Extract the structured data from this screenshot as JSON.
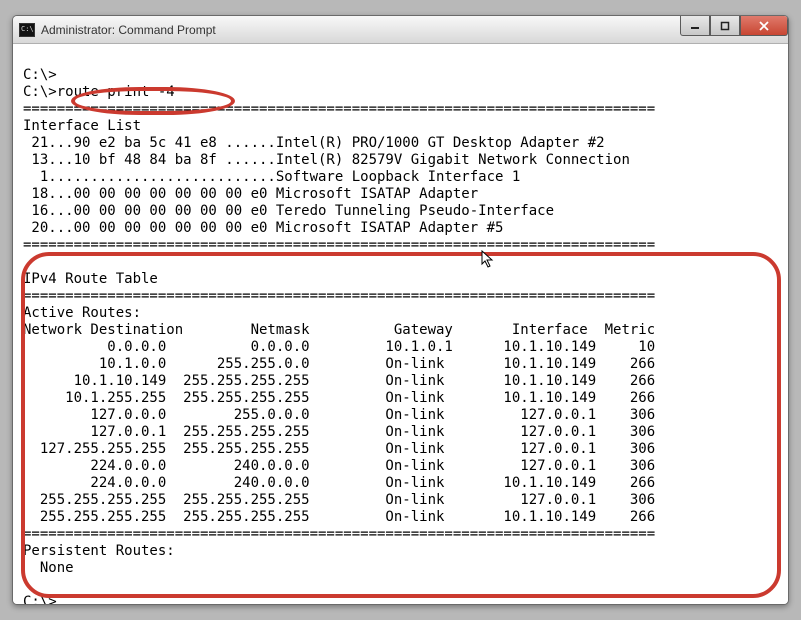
{
  "window": {
    "title": "Administrator: Command Prompt"
  },
  "prompts": {
    "p1": "C:\\>",
    "p2": "C:\\>",
    "p3": "C:\\>"
  },
  "command": "route print -4",
  "divider": "===========================================================================",
  "interface_list_heading": "Interface List",
  "interfaces": {
    "l1": " 21...90 e2 ba 5c 41 e8 ......Intel(R) PRO/1000 GT Desktop Adapter #2",
    "l2": " 13...10 bf 48 84 ba 8f ......Intel(R) 82579V Gigabit Network Connection",
    "l3": "  1...........................Software Loopback Interface 1",
    "l4": " 18...00 00 00 00 00 00 00 e0 Microsoft ISATAP Adapter",
    "l5": " 16...00 00 00 00 00 00 00 e0 Teredo Tunneling Pseudo-Interface",
    "l6": " 20...00 00 00 00 00 00 00 e0 Microsoft ISATAP Adapter #5"
  },
  "route_table": {
    "title": "IPv4 Route Table",
    "active_heading": "Active Routes:",
    "header": "Network Destination        Netmask          Gateway       Interface  Metric",
    "rows": [
      "          0.0.0.0          0.0.0.0         10.1.0.1      10.1.10.149     10",
      "         10.1.0.0      255.255.0.0         On-link       10.1.10.149    266",
      "      10.1.10.149  255.255.255.255         On-link       10.1.10.149    266",
      "     10.1.255.255  255.255.255.255         On-link       10.1.10.149    266",
      "        127.0.0.0        255.0.0.0         On-link         127.0.0.1    306",
      "        127.0.0.1  255.255.255.255         On-link         127.0.0.1    306",
      "  127.255.255.255  255.255.255.255         On-link         127.0.0.1    306",
      "        224.0.0.0        240.0.0.0         On-link         127.0.0.1    306",
      "        224.0.0.0        240.0.0.0         On-link       10.1.10.149    266",
      "  255.255.255.255  255.255.255.255         On-link         127.0.0.1    306",
      "  255.255.255.255  255.255.255.255         On-link       10.1.10.149    266"
    ],
    "persistent_heading": "Persistent Routes:",
    "persistent_value": "  None"
  }
}
